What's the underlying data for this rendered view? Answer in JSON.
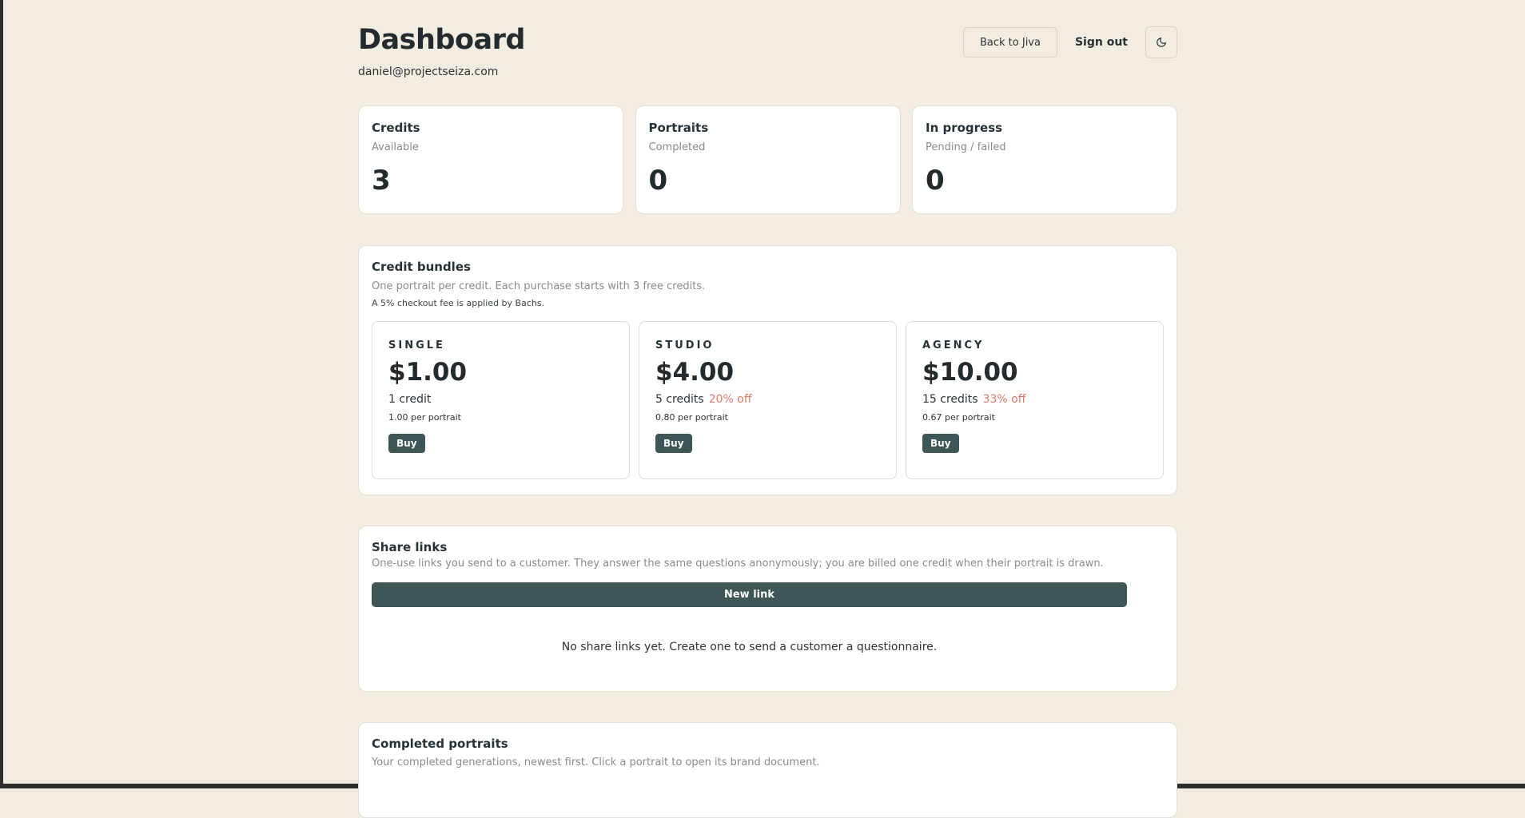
{
  "header": {
    "title": "Dashboard",
    "email": "daniel@projectseiza.com",
    "back_label": "Back to Jiva",
    "signout_label": "Sign out",
    "theme_icon": "moon-icon"
  },
  "stats": [
    {
      "label": "Credits",
      "sub": "Available",
      "value": "3"
    },
    {
      "label": "Portraits",
      "sub": "Completed",
      "value": "0"
    },
    {
      "label": "In progress",
      "sub": "Pending / failed",
      "value": "0"
    }
  ],
  "bundles": {
    "title": "Credit bundles",
    "desc": "One portrait per credit. Each purchase starts with 3 free credits.",
    "note": "A 5% checkout fee is applied by Bachs.",
    "items": [
      {
        "name": "SINGLE",
        "price": "$1.00",
        "credits": "1 credit",
        "discount": "",
        "per": "1.00 per portrait",
        "buy": "Buy"
      },
      {
        "name": "STUDIO",
        "price": "$4.00",
        "credits": "5 credits",
        "discount": "20% off",
        "per": "0.80 per portrait",
        "buy": "Buy"
      },
      {
        "name": "AGENCY",
        "price": "$10.00",
        "credits": "15 credits",
        "discount": "33% off",
        "per": "0.67 per portrait",
        "buy": "Buy"
      }
    ]
  },
  "share": {
    "title": "Share links",
    "desc": "One-use links you send to a customer. They answer the same questions anonymously; you are billed one credit when their portrait is drawn.",
    "new_link_label": "New link",
    "empty": "No share links yet. Create one to send a customer a questionnaire."
  },
  "completed": {
    "title": "Completed portraits",
    "desc": "Your completed generations, newest first. Click a portrait to open its brand document."
  },
  "colors": {
    "background": "#f3ece1",
    "primary_button": "#3f5656",
    "discount": "#d9796a"
  }
}
